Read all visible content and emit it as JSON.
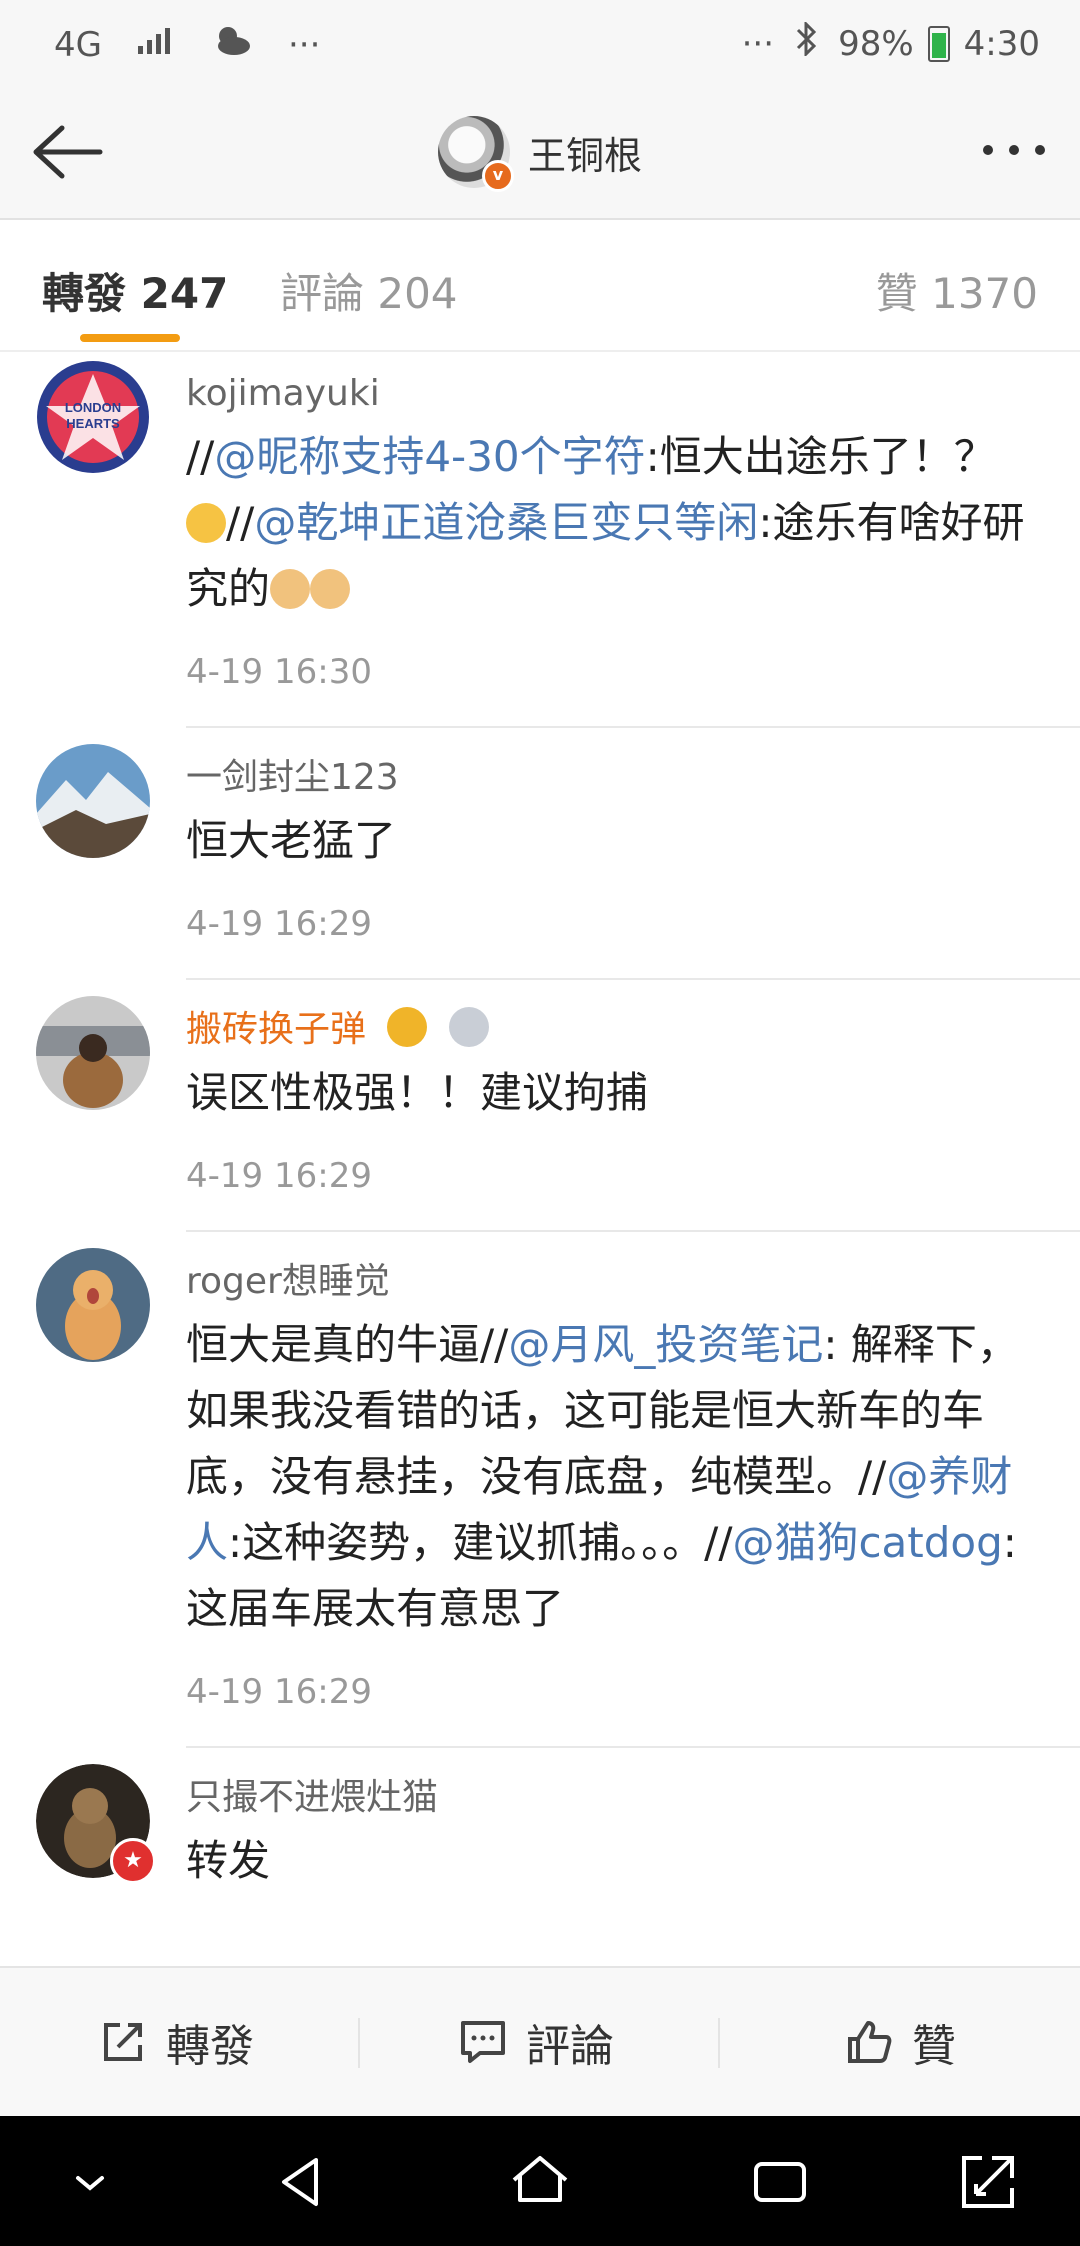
{
  "status": {
    "network": "4G",
    "more": "···",
    "battery": "98%",
    "time": "4:30"
  },
  "nav": {
    "title": "王铜根"
  },
  "tabs": {
    "reposts": "轉發 247",
    "comments": "評論 204",
    "likes": "贊 1370"
  },
  "items": [
    {
      "user": "kojimayuki",
      "avatar_text": "LONDON HEARTS",
      "parts": [
        {
          "t": "//"
        },
        {
          "t": "@昵称支持4-30个字符",
          "m": 1
        },
        {
          "t": ":恒大出途乐了！？"
        },
        {
          "t": "//"
        },
        {
          "t": "@乾坤正道沧桑巨变只等闲",
          "m": 1
        },
        {
          "t": ":途乐有啥好研究的"
        }
      ],
      "time": "4-19 16:30"
    },
    {
      "user": "一剑封尘123",
      "parts": [
        {
          "t": "恒大老猛了"
        }
      ],
      "time": "4-19 16:29"
    },
    {
      "user": "搬砖换子弹",
      "parts": [
        {
          "t": "误区性极强！！建议拘捕"
        }
      ],
      "time": "4-19 16:29"
    },
    {
      "user": "roger想睡觉",
      "parts": [
        {
          "t": "恒大是真的牛逼//"
        },
        {
          "t": "@月风_投资笔记",
          "m": 1
        },
        {
          "t": ": 解释下，如果我没看错的话，这可能是恒大新车的车底，没有悬挂，没有底盘，纯模型。//"
        },
        {
          "t": "@养财人",
          "m": 1
        },
        {
          "t": ":这种姿势，建议抓捕。。。//"
        },
        {
          "t": "@猫狗catdog",
          "m": 1
        },
        {
          "t": ": 这届车展太有意思了"
        }
      ],
      "time": "4-19 16:29"
    },
    {
      "user": "只撮不进煨灶猫",
      "parts": [
        {
          "t": "转发"
        }
      ],
      "time": ""
    }
  ],
  "bottom": {
    "repost": "轉發",
    "comment": "評論",
    "like": "贊"
  },
  "colors": {
    "mention": "#4a78b3",
    "orange_name": "#e8701a",
    "tab_indicator": "#f39c12"
  }
}
